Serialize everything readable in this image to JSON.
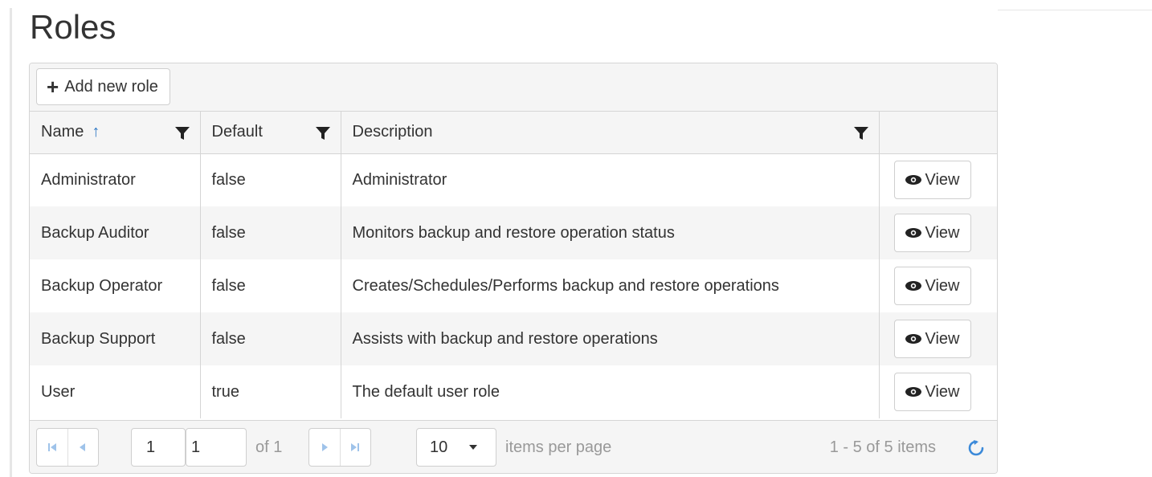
{
  "page": {
    "title": "Roles"
  },
  "toolbar": {
    "add_label": "Add new role"
  },
  "columns": [
    {
      "label": "Name",
      "sorted": "ascending",
      "filterable": true
    },
    {
      "label": "Default",
      "filterable": true
    },
    {
      "label": "Description",
      "filterable": true
    },
    {
      "label": ""
    }
  ],
  "rows": [
    {
      "name": "Administrator",
      "default": "false",
      "description": "Administrator",
      "action": "View"
    },
    {
      "name": "Backup Auditor",
      "default": "false",
      "description": "Monitors backup and restore operation status",
      "action": "View"
    },
    {
      "name": "Backup Operator",
      "default": "false",
      "description": "Creates/Schedules/Performs backup and restore operations",
      "action": "View"
    },
    {
      "name": "Backup Support",
      "default": "false",
      "description": "Assists with backup and restore operations",
      "action": "View"
    },
    {
      "name": "User",
      "default": "true",
      "description": "The default user role",
      "action": "View"
    }
  ],
  "pager": {
    "current_page": "1",
    "page_input": "1",
    "of_label": "of 1",
    "page_size": "10",
    "items_per_page_label": "items per page",
    "summary": "1 - 5 of 5 items"
  },
  "colors": {
    "accent": "#3c8ad9",
    "sort_arrow": "#2f78c4",
    "header_bg": "#f5f5f5",
    "border": "#d5d5d5"
  },
  "icons": [
    "plus-icon",
    "sort-ascending-icon",
    "filter-icon",
    "eye-icon",
    "first-page-icon",
    "prev-page-icon",
    "next-page-icon",
    "last-page-icon",
    "dropdown-caret-icon",
    "refresh-icon"
  ]
}
